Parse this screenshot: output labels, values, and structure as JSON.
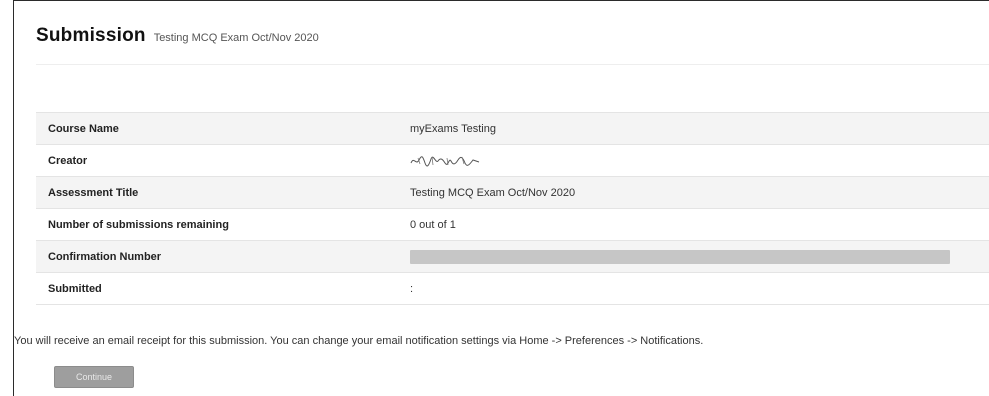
{
  "header": {
    "title": "Submission",
    "subtitle": "Testing MCQ Exam Oct/Nov 2020"
  },
  "details": [
    {
      "label": "Course Name",
      "value": "myExams Testing"
    },
    {
      "label": "Creator",
      "value": ""
    },
    {
      "label": "Assessment Title",
      "value": "Testing MCQ Exam Oct/Nov 2020"
    },
    {
      "label": "Number of submissions remaining",
      "value": "0 out of 1"
    },
    {
      "label": "Confirmation Number",
      "value": ""
    },
    {
      "label": "Submitted",
      "value": ":"
    }
  ],
  "notice": "You will receive an email receipt for this submission. You can change your email notification settings via Home -> Preferences -> Notifications.",
  "actions": {
    "continue_label": "Continue"
  },
  "colors": {
    "row_alt": "#f4f4f4",
    "button": "#9e9e9e",
    "redaction": "#c6c6c6"
  }
}
